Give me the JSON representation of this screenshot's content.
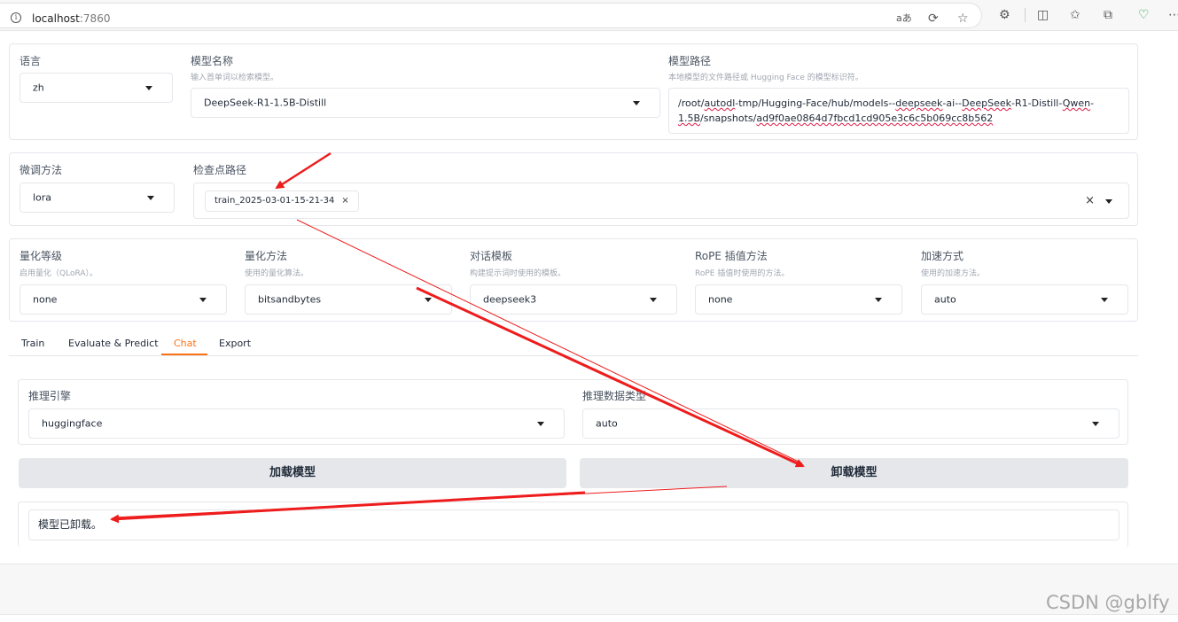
{
  "browser": {
    "url_host": "localhost",
    "url_port": ":7860",
    "icons": [
      "info-icon",
      "read-aloud-icon",
      "refresh-icon",
      "favorite-star-icon",
      "extensions-icon",
      "split-screen-icon",
      "favorites-icon",
      "collections-icon",
      "browser-essentials-icon",
      "more-icon"
    ]
  },
  "top": {
    "language": {
      "label": "语言",
      "value": "zh"
    },
    "model_name": {
      "label": "模型名称",
      "hint": "输入首单词以检索模型。",
      "value": "DeepSeek-R1-1.5B-Distill"
    },
    "model_path": {
      "label": "模型路径",
      "hint": "本地模型的文件路径或 Hugging Face 的模型标识符。",
      "line1_a": "/root/",
      "line1_b": "autodl",
      "line1_c": "-tmp/Hugging-Face/hub/models--",
      "line1_d": "deepseek",
      "line1_e": "-ai--",
      "line1_f": "DeepSeek",
      "line1_g": "-R1-Distill-",
      "line1_h": "Qwen",
      "line1_i": "-",
      "line2_a": "1.5B",
      "line2_b": "/snapshots/",
      "line2_c": "ad9f0ae0864d7fbcd1cd905e3c6c5b069cc8b562"
    }
  },
  "finetune": {
    "method": {
      "label": "微调方法",
      "value": "lora"
    },
    "checkpoint": {
      "label": "检查点路径",
      "chip": "train_2025-03-01-15-21-34",
      "chip_close": "×",
      "clear": "×"
    }
  },
  "advanced": {
    "quant_bit": {
      "label": "量化等级",
      "hint": "启用量化（QLoRA）。",
      "value": "none"
    },
    "quant_method": {
      "label": "量化方法",
      "hint": "使用的量化算法。",
      "value": "bitsandbytes"
    },
    "template": {
      "label": "对话模板",
      "hint": "构建提示词时使用的模板。",
      "value": "deepseek3"
    },
    "rope": {
      "label": "RoPE 插值方法",
      "hint": "RoPE 插值时使用的方法。",
      "value": "none"
    },
    "booster": {
      "label": "加速方式",
      "hint": "使用的加速方法。",
      "value": "auto"
    }
  },
  "tabs": [
    {
      "label": "Train",
      "active": false
    },
    {
      "label": "Evaluate & Predict",
      "active": false
    },
    {
      "label": "Chat",
      "active": true
    },
    {
      "label": "Export",
      "active": false
    }
  ],
  "chat": {
    "infer_backend": {
      "label": "推理引擎",
      "value": "huggingface"
    },
    "infer_dtype": {
      "label": "推理数据类型",
      "value": "auto"
    },
    "load_button": "加载模型",
    "unload_button": "卸载模型",
    "info_box": "模型已卸载。"
  },
  "watermark": "CSDN @gblfy",
  "colors": {
    "accent": "#f97316",
    "arrow": "#ee1c1c",
    "button_bg": "#e5e7eb"
  }
}
